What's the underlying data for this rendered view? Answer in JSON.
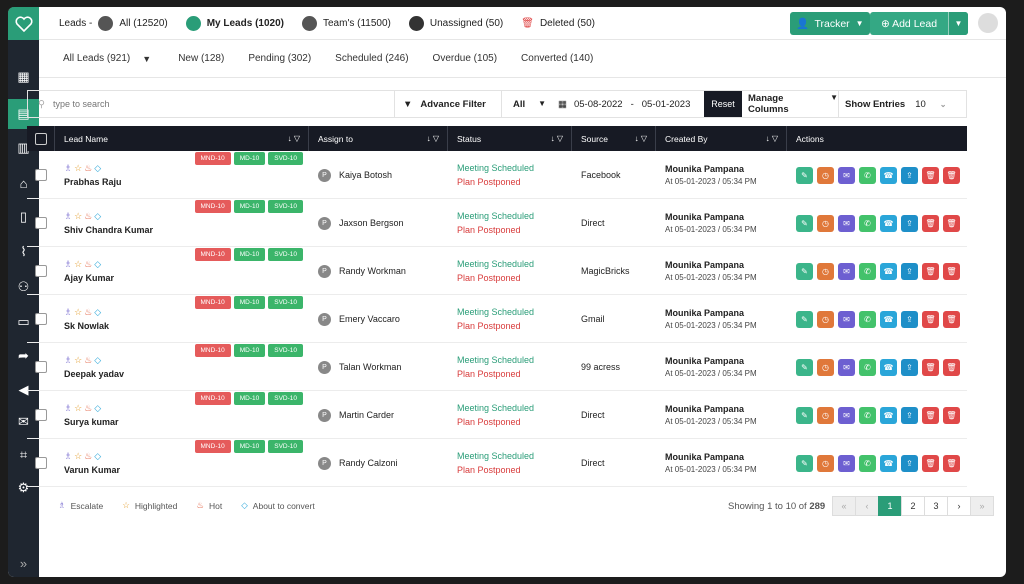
{
  "topbar": {
    "leads_label": "Leads -",
    "items": [
      {
        "label": "All (12520)"
      },
      {
        "label": "My Leads (1020)"
      },
      {
        "label": "Team's (11500)"
      },
      {
        "label": "Unassigned (50)"
      },
      {
        "label": "Deleted (50)"
      }
    ],
    "tracker_label": "Tracker",
    "add_lead_label": "Add Lead"
  },
  "tabs": [
    {
      "label": "All Leads (921)"
    },
    {
      "label": "New (128)"
    },
    {
      "label": "Pending (302)"
    },
    {
      "label": "Scheduled (246)"
    },
    {
      "label": "Overdue (105)"
    },
    {
      "label": "Converted (140)"
    }
  ],
  "filter": {
    "search_placeholder": "type to search",
    "advance_filter": "Advance Filter",
    "select_value": "All",
    "date_from": "05-08-2022",
    "date_sep": "-",
    "date_to": "05-01-2023",
    "reset": "Reset",
    "manage_columns": "Manage Columns",
    "show_entries": "Show Entries",
    "entries_value": "10"
  },
  "table": {
    "headers": {
      "lead_name": "Lead Name",
      "assign_to": "Assign to",
      "status": "Status",
      "source": "Source",
      "created_by": "Created By",
      "actions": "Actions"
    },
    "tags": [
      "MND-10",
      "MD-10",
      "SVD-10"
    ],
    "rows": [
      {
        "name": "Prabhas Raju",
        "assign": "Kaiya Botosh",
        "status1": "Meeting Scheduled",
        "status2": "Plan Postponed",
        "source": "Facebook",
        "created": "Mounika Pampana",
        "time": "At 05-01-2023 / 05:34 PM"
      },
      {
        "name": "Shiv Chandra Kumar",
        "assign": "Jaxson Bergson",
        "status1": "Meeting Scheduled",
        "status2": "Plan Postponed",
        "source": "Direct",
        "created": "Mounika Pampana",
        "time": "At 05-01-2023 / 05:34 PM"
      },
      {
        "name": "Ajay Kumar",
        "assign": "Randy Workman",
        "status1": "Meeting Scheduled",
        "status2": "Plan Postponed",
        "source": "MagicBricks",
        "created": "Mounika Pampana",
        "time": "At 05-01-2023 / 05:34 PM"
      },
      {
        "name": "Sk Nowlak",
        "assign": "Emery Vaccaro",
        "status1": "Meeting Scheduled",
        "status2": "Plan Postponed",
        "source": "Gmail",
        "created": "Mounika Pampana",
        "time": "At 05-01-2023 / 05:34 PM"
      },
      {
        "name": "Deepak yadav",
        "assign": "Talan Workman",
        "status1": "Meeting Scheduled",
        "status2": "Plan Postponed",
        "source": "99 acress",
        "created": "Mounika Pampana",
        "time": "At 05-01-2023 / 05:34 PM"
      },
      {
        "name": "Surya kumar",
        "assign": "Martin Carder",
        "status1": "Meeting Scheduled",
        "status2": "Plan Postponed",
        "source": "Direct",
        "created": "Mounika Pampana",
        "time": "At 05-01-2023 / 05:34 PM"
      },
      {
        "name": "Varun Kumar",
        "assign": "Randy Calzoni",
        "status1": "Meeting Scheduled",
        "status2": "Plan Postponed",
        "source": "Direct",
        "created": "Mounika Pampana",
        "time": "At 05-01-2023 / 05:34 PM"
      }
    ],
    "action_icons": [
      {
        "name": "edit-icon",
        "color": "#3bb58a",
        "glyph": "✎"
      },
      {
        "name": "history-icon",
        "color": "#e0783a",
        "glyph": "◷"
      },
      {
        "name": "mail-icon",
        "color": "#6d5fd1",
        "glyph": "✉"
      },
      {
        "name": "whatsapp-icon",
        "color": "#43c26b",
        "glyph": "✆"
      },
      {
        "name": "phone-icon",
        "color": "#2aa6d9",
        "glyph": "☎"
      },
      {
        "name": "upload-icon",
        "color": "#1e8fc8",
        "glyph": "⇪"
      },
      {
        "name": "delete-icon",
        "color": "#e04848",
        "glyph": "🗑"
      },
      {
        "name": "trash-icon",
        "color": "#e04848",
        "glyph": "🗑"
      }
    ]
  },
  "legend": [
    {
      "icon": "escalate-icon",
      "label": "Escalate"
    },
    {
      "icon": "star-icon",
      "label": "Highlighted"
    },
    {
      "icon": "fire-icon",
      "label": "Hot"
    },
    {
      "icon": "diamond-icon",
      "label": "About to convert"
    }
  ],
  "pagination": {
    "showing_prefix": "Showing 1 to 10 of",
    "total": "289",
    "pages": [
      "1",
      "2",
      "3"
    ]
  },
  "colors": {
    "accent": "#2a9d78",
    "sidebar": "#1f2630",
    "header": "#171a24"
  }
}
